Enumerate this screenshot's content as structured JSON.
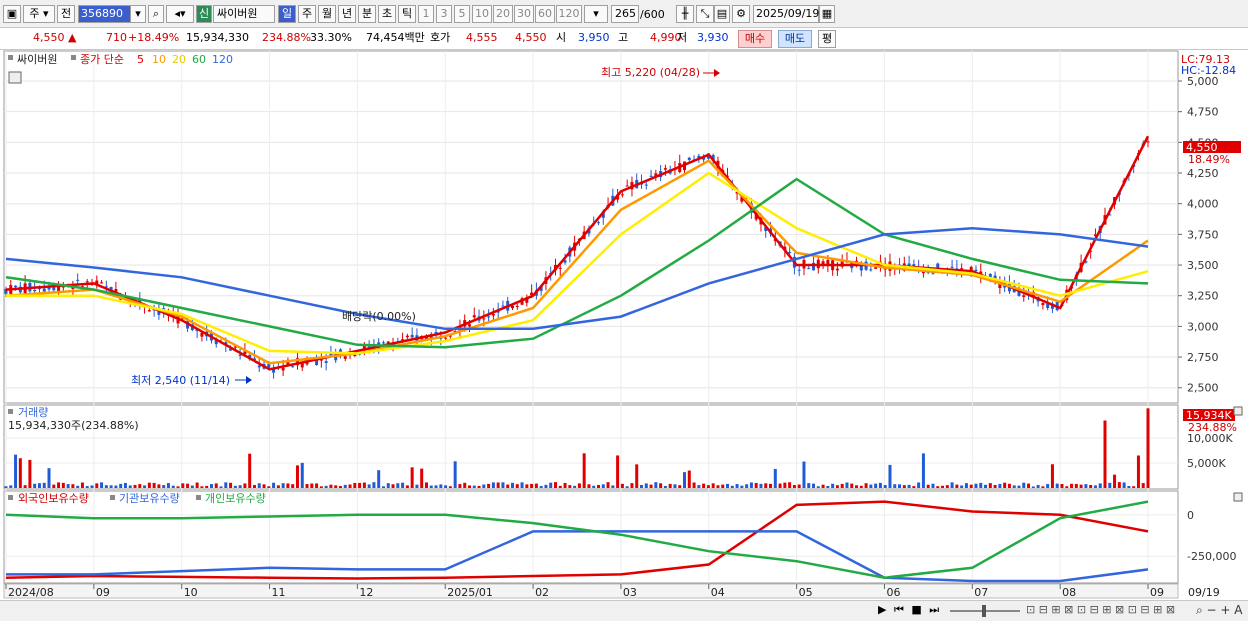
{
  "toolbar": {
    "mode_primary": "주",
    "mode_prev": "전",
    "stock_code": "356890",
    "badge_new": "신",
    "stock_name": "싸이버원",
    "periods": [
      "일",
      "주",
      "월",
      "년",
      "분",
      "초",
      "틱"
    ],
    "active_period": "일",
    "minute_options": [
      "1",
      "3",
      "5",
      "10",
      "20",
      "30",
      "60",
      "120"
    ],
    "bar_count": "265",
    "bar_total": "/600",
    "date": "2025/09/19"
  },
  "quote": {
    "price": "4,550",
    "change": "710",
    "change_pct": "+18.49%",
    "volume": "15,934,330",
    "volume_ratio": "234.88%",
    "turnover": "33.30%",
    "amount": "74,454백만",
    "bid_label": "호가",
    "ask": "4,555",
    "bid": "4,550",
    "open_label": "시",
    "open": "3,950",
    "high_label": "고",
    "high": "4,990",
    "low_label": "저",
    "low": "3,930",
    "buy_label": "매수",
    "sell_label": "매도",
    "avg_label": "평"
  },
  "price_panel": {
    "legend_name": "싸이버원",
    "legend_type": "종가 단순",
    "ma_periods": [
      "5",
      "10",
      "20",
      "60",
      "120"
    ],
    "ma_colors": [
      "#e00000",
      "#ff9900",
      "#ffee00",
      "#22aa44",
      "#3366dd"
    ],
    "lc": "LC:79.13",
    "hc": "HC:-12.84",
    "current_price_tag": "4,550",
    "current_pct_tag": "18.49%",
    "annotation_high": "최고 5,220 (04/28)",
    "annotation_low": "최저 2,540 (11/14)",
    "annotation_dividend": "배당락(0.00%)"
  },
  "volume_panel": {
    "title": "거래량",
    "value_text": "15,934,330주(234.88%)",
    "tag_value": "15,934K",
    "tag_pct": "234.88%"
  },
  "holdings_panel": {
    "series_labels": [
      "외국인보유수량",
      "기관보유수량",
      "개인보유수량"
    ],
    "series_colors": [
      "#e00000",
      "#3366dd",
      "#22aa44"
    ]
  },
  "x_axis": {
    "labels": [
      "2024/08",
      "09",
      "10",
      "11",
      "12",
      "2025/01",
      "02",
      "03",
      "04",
      "05",
      "06",
      "07",
      "08",
      "09"
    ],
    "right_label": "09/19"
  },
  "chart_data": [
    {
      "type": "line",
      "title": "싸이버원",
      "x": [
        "2024/08",
        "2024/09",
        "2024/10",
        "2024/11",
        "2024/12",
        "2025/01",
        "2025/02",
        "2025/03",
        "2025/04",
        "2025/05",
        "2025/06",
        "2025/07",
        "2025/08",
        "2025/09"
      ],
      "series": [
        {
          "name": "5",
          "values": [
            3300,
            3350,
            3050,
            2650,
            2800,
            2950,
            3250,
            4100,
            4400,
            3500,
            3500,
            3450,
            3150,
            4550
          ]
        },
        {
          "name": "10",
          "values": [
            3250,
            3300,
            3080,
            2700,
            2780,
            2920,
            3150,
            3950,
            4350,
            3600,
            3480,
            3420,
            3200,
            3700
          ]
        },
        {
          "name": "20",
          "values": [
            3250,
            3250,
            3100,
            2800,
            2780,
            2880,
            3050,
            3750,
            4250,
            3800,
            3500,
            3430,
            3250,
            3450
          ]
        },
        {
          "name": "60",
          "values": [
            3400,
            3300,
            3150,
            3000,
            2850,
            2830,
            2900,
            3250,
            3700,
            4200,
            3750,
            3550,
            3380,
            3350
          ]
        },
        {
          "name": "120",
          "values": [
            3550,
            3480,
            3400,
            3250,
            3100,
            2980,
            2980,
            3080,
            3350,
            3550,
            3750,
            3800,
            3750,
            3650
          ]
        }
      ],
      "ylim": [
        2400,
        5220
      ],
      "yticks": [
        2500,
        2750,
        3000,
        3250,
        3500,
        3750,
        4000,
        4250,
        4500,
        4750,
        5000
      ],
      "ytick_labels": [
        "2,500",
        "2,750",
        "3,000",
        "3,250",
        "3,500",
        "3,750",
        "4,000",
        "4,250",
        "4,500",
        "4,750",
        "5,000"
      ],
      "high": 5220,
      "low": 2540,
      "last": 4550
    },
    {
      "type": "bar",
      "title": "거래량",
      "ylim": [
        0,
        16000
      ],
      "yticks": [
        5000,
        10000
      ],
      "ytick_labels": [
        "5,000K",
        "10,000K"
      ],
      "last": 15934
    },
    {
      "type": "line",
      "title": "보유수량",
      "ylim": [
        -400000,
        120000
      ],
      "yticks": [
        0,
        -250000
      ],
      "ytick_labels": [
        "0",
        "-250,000"
      ],
      "series": [
        {
          "name": "외국인보유수량",
          "values": [
            -380000,
            -370000,
            -375000,
            -380000,
            -385000,
            -380000,
            -370000,
            -360000,
            -300000,
            60000,
            80000,
            20000,
            0,
            -100000
          ]
        },
        {
          "name": "기관보유수량",
          "values": [
            -360000,
            -360000,
            -340000,
            -320000,
            -330000,
            -330000,
            -100000,
            -100000,
            -100000,
            -100000,
            -380000,
            -400000,
            -400000,
            -330000
          ]
        },
        {
          "name": "개인보유수량",
          "values": [
            0,
            -20000,
            -20000,
            -10000,
            0,
            0,
            -50000,
            -120000,
            -220000,
            -280000,
            -380000,
            -320000,
            -20000,
            80000
          ]
        }
      ]
    }
  ]
}
